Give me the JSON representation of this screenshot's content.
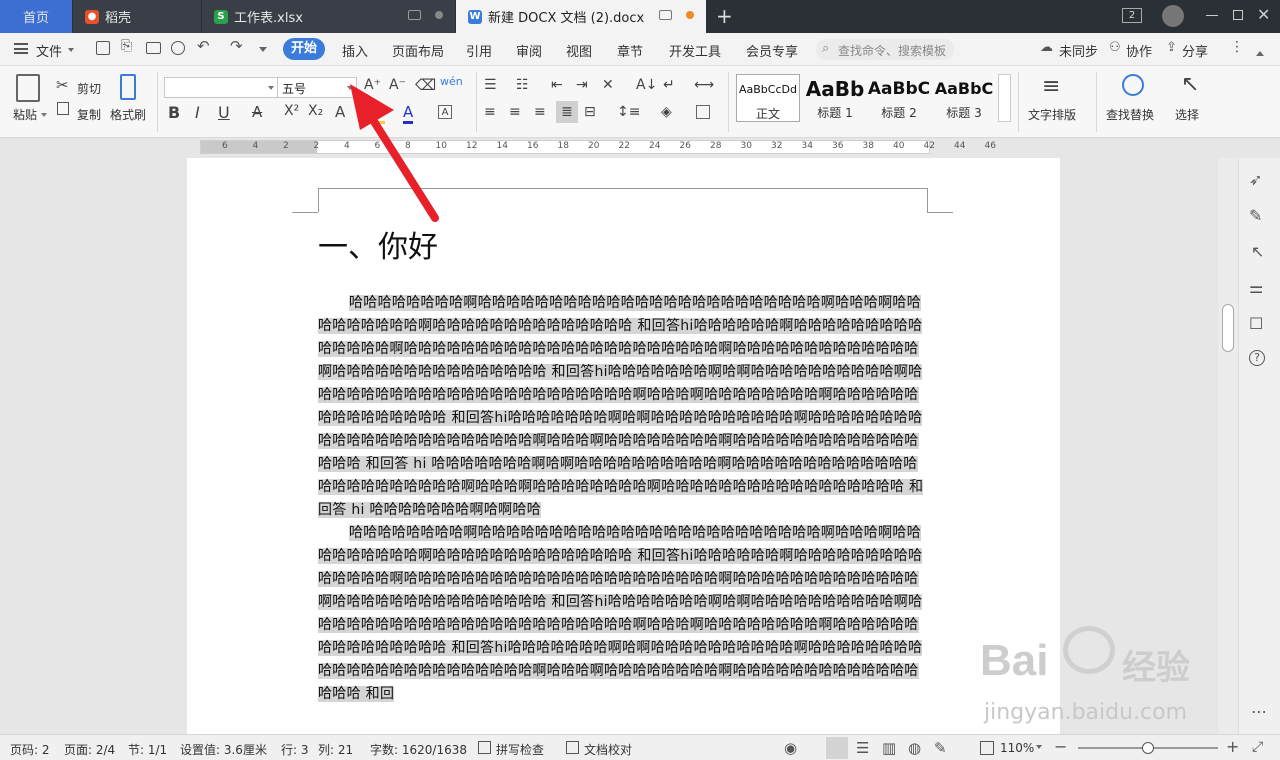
{
  "tabs": [
    {
      "label": "首页"
    },
    {
      "label": "稻壳"
    },
    {
      "label": "工作表.xlsx"
    },
    {
      "label": "新建 DOCX 文档 (2).docx"
    }
  ],
  "window": {
    "badge": "2"
  },
  "menu": {
    "file": "文件",
    "start": "开始",
    "items": [
      "插入",
      "页面布局",
      "引用",
      "审阅",
      "视图",
      "章节",
      "开发工具",
      "会员专享"
    ],
    "search": "查找命令、搜索模板",
    "sync": "未同步",
    "collab": "协作",
    "share": "分享"
  },
  "ribbon": {
    "paste": "粘贴",
    "cut": "剪切",
    "copy": "复制",
    "format_painter": "格式刷",
    "font_name": "",
    "font_size": "五号",
    "styles": [
      {
        "preview": "AaBbCcDd",
        "name": "正文"
      },
      {
        "preview": "AaBb",
        "name": "标题 1"
      },
      {
        "preview": "AaBbC",
        "name": "标题 2"
      },
      {
        "preview": "AaBbC",
        "name": "标题 3"
      }
    ],
    "text_layout": "文字排版",
    "find_replace": "查找替换",
    "select": "选择"
  },
  "ruler_ticks": [
    "6",
    "4",
    "2",
    "2",
    "4",
    "6",
    "8",
    "10",
    "12",
    "14",
    "16",
    "18",
    "20",
    "22",
    "24",
    "26",
    "28",
    "30",
    "32",
    "34",
    "36",
    "38",
    "40",
    "42",
    "44",
    "46"
  ],
  "document": {
    "heading": "一、你好",
    "para1": "哈哈哈哈哈哈哈哈啊哈哈哈哈哈哈哈哈哈哈哈哈哈哈哈哈哈哈哈哈哈哈哈哈啊哈哈哈啊哈哈哈哈哈哈哈哈哈啊哈哈哈哈哈哈哈哈哈哈哈哈哈哈 和回答hi哈哈哈哈哈哈啊哈哈哈哈哈哈哈哈哈哈哈哈哈哈啊哈哈哈哈哈哈哈哈哈哈哈哈哈哈哈哈哈哈哈哈哈哈啊哈哈哈哈哈哈哈哈哈哈哈哈哈啊哈哈哈哈哈哈哈哈哈哈哈哈哈哈哈 和回答hi哈哈哈哈哈哈哈啊哈啊哈哈哈哈哈哈哈哈哈哈啊哈哈哈哈哈哈哈哈哈哈哈哈哈哈哈哈哈哈哈哈哈哈哈啊哈哈哈啊哈哈哈哈哈哈哈哈啊哈哈哈哈哈哈哈哈哈哈哈哈哈哈哈 和回答hi哈哈哈哈哈哈哈啊哈啊哈哈哈哈哈哈哈哈哈哈啊哈哈哈哈哈哈哈哈哈哈哈哈哈哈哈哈哈哈哈哈哈哈哈啊哈哈哈啊哈哈哈哈哈哈哈哈啊哈哈哈哈哈哈哈哈哈哈哈哈哈哈哈哈 和回答 hi 哈哈哈哈哈哈哈啊哈啊哈哈哈哈哈哈哈哈哈哈啊哈哈哈哈哈哈哈哈哈哈哈哈哈哈哈哈哈哈哈哈哈哈哈啊哈哈哈啊哈哈哈哈哈哈哈哈啊哈哈哈哈哈哈哈哈哈哈哈哈哈哈哈哈哈 和回答 hi 哈哈哈哈哈哈哈啊哈啊哈哈",
    "para2": "哈哈哈哈哈哈哈哈啊哈哈哈哈哈哈哈哈哈哈哈哈哈哈哈哈哈哈哈哈哈哈哈哈啊哈哈哈啊哈哈哈哈哈哈哈哈哈啊哈哈哈哈哈哈哈哈哈哈哈哈哈哈 和回答hi哈哈哈哈哈哈啊哈哈哈哈哈哈哈哈哈哈哈哈哈哈啊哈哈哈哈哈哈哈哈哈哈哈哈哈哈哈哈哈哈哈哈哈哈啊哈哈哈哈哈哈哈哈哈哈哈哈哈啊哈哈哈哈哈哈哈哈哈哈哈哈哈哈哈 和回答hi哈哈哈哈哈哈哈啊哈啊哈哈哈哈哈哈哈哈哈哈啊哈哈哈哈哈哈哈哈哈哈哈哈哈哈哈哈哈哈哈哈哈哈哈啊哈哈哈啊哈哈哈哈哈哈哈哈啊哈哈哈哈哈哈哈哈哈哈哈哈哈哈哈 和回答hi哈哈哈哈哈哈哈啊哈啊哈哈哈哈哈哈哈哈哈哈啊哈哈哈哈哈哈哈哈哈哈哈哈哈哈哈哈哈哈哈哈哈哈哈啊哈哈哈啊哈哈哈哈哈哈哈哈啊哈哈哈哈哈哈哈哈哈哈哈哈哈哈哈哈 和回"
  },
  "watermark": {
    "brand": "Bai",
    "brand2": "经验",
    "url": "jingyan.baidu.com"
  },
  "status": {
    "page": "页码: 2",
    "pages": "页面: 2/4",
    "section": "节: 1/1",
    "setting": "设置值: 3.6厘米",
    "row": "行: 3",
    "col": "列: 21",
    "words": "字数: 1620/1638",
    "spell": "拼写检查",
    "proof": "文档校对",
    "zoom": "110%"
  },
  "colors": {
    "accent": "#3a7cdb",
    "arrow": "#e8202a",
    "tabbar": "#2b2f36"
  }
}
